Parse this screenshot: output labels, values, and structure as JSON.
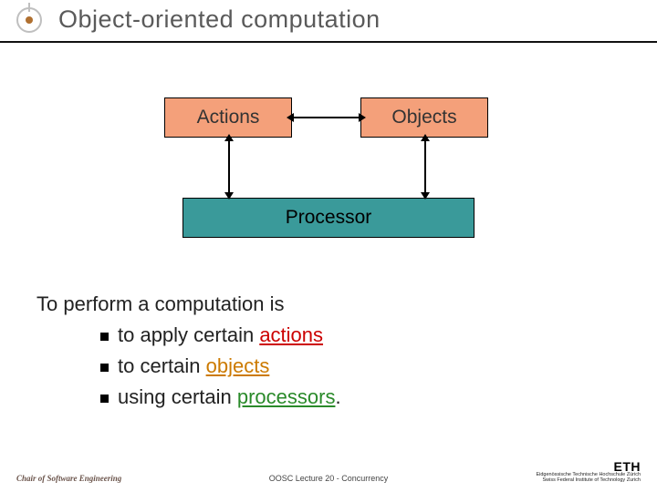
{
  "title": "Object-oriented computation",
  "diagram": {
    "actions": "Actions",
    "objects": "Objects",
    "processor": "Processor"
  },
  "body": {
    "lead": "To perform a computation is",
    "items": [
      {
        "prefix": "to apply certain ",
        "kw": "actions",
        "kw_class": "kw-actions",
        "suffix": ""
      },
      {
        "prefix": "to certain ",
        "kw": "objects",
        "kw_class": "kw-objects",
        "suffix": ""
      },
      {
        "prefix": "using certain ",
        "kw": "processors",
        "kw_class": "kw-proc",
        "suffix": "."
      }
    ]
  },
  "footer": {
    "left": "Chair of Software Engineering",
    "center": "OOSC  Lecture 20 - Concurrency",
    "eth_line1": "ETH",
    "eth_line2": "Eidgenössische Technische Hochschule Zürich",
    "eth_line3": "Swiss Federal Institute of Technology Zurich"
  }
}
